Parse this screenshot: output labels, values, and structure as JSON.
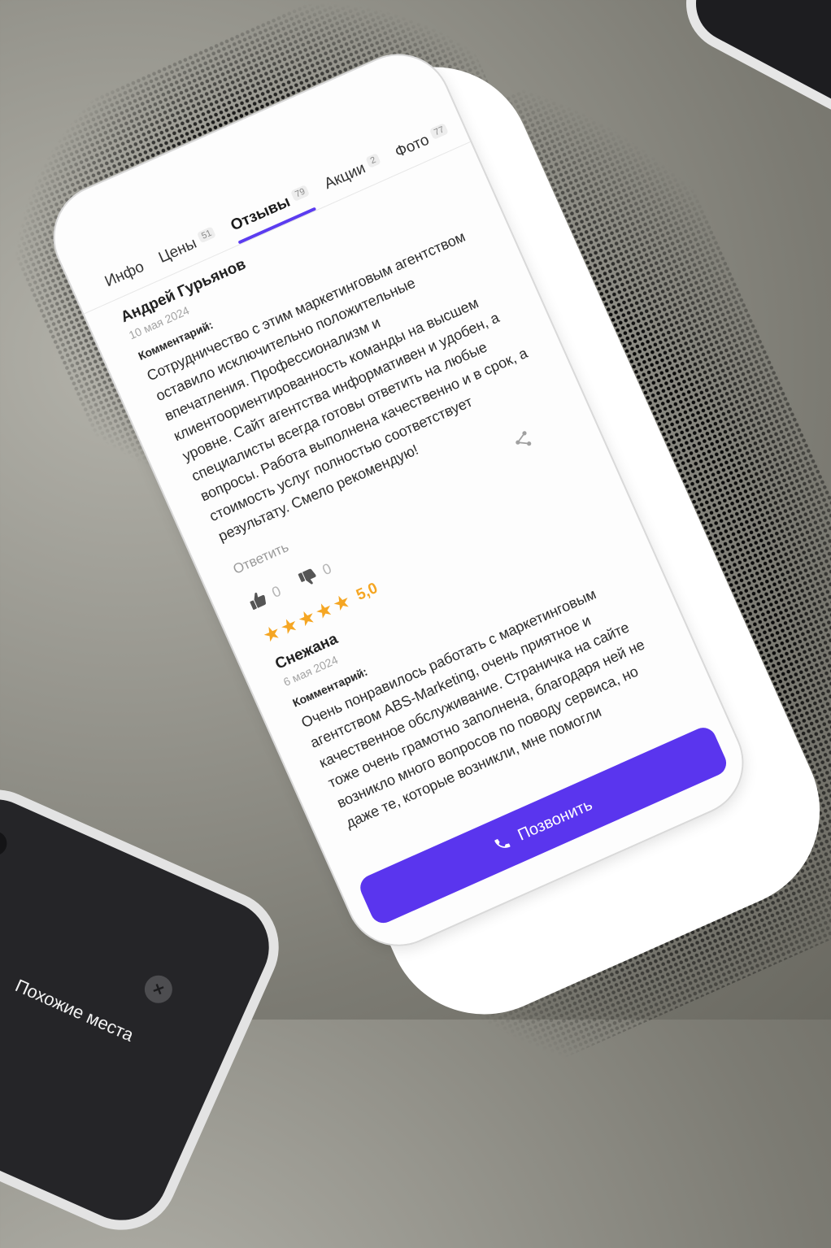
{
  "tabs": [
    {
      "label": "Инфо",
      "count": ""
    },
    {
      "label": "Цены",
      "count": "51"
    },
    {
      "label": "Отзывы",
      "count": "79"
    },
    {
      "label": "Акции",
      "count": "2"
    },
    {
      "label": "Фото",
      "count": "77"
    }
  ],
  "review1": {
    "author": "Андрей Гурьянов",
    "date": "10 мая 2024",
    "comment_label": "Комментарий:",
    "text": "Сотрудничество с этим маркетинговым агентством оставило исключительно положительные впечатления. Профессионализм и клиентоориентированность команды на высшем уровне. Сайт агентства информативен и удобен, а специалисты всегда готовы ответить на любые вопросы. Работа выполнена качественно и в срок, а стоимость услуг полностью соответствует результату. Смело рекомендую!",
    "reply_label": "Ответить",
    "likes": "0",
    "dislikes": "0"
  },
  "review2": {
    "rating": "5,0",
    "author": "Снежана",
    "date": "6 мая 2024",
    "comment_label": "Комментарий:",
    "text": "Очень понравилось работать с маркетинговым агентством ABS-Marketing, очень приятное и качественное обслуживание. Страничка на сайте тоже очень грамотно заполнена, благодаря ней не возникло много вопросов по поводу сервиса, но даже те, которые возникли, мне помогли"
  },
  "call_button": {
    "label": "Позвонить"
  },
  "background_phone": {
    "label": "Похожие места"
  },
  "colors": {
    "accent": "#5a35ee",
    "star": "#f5a623"
  }
}
